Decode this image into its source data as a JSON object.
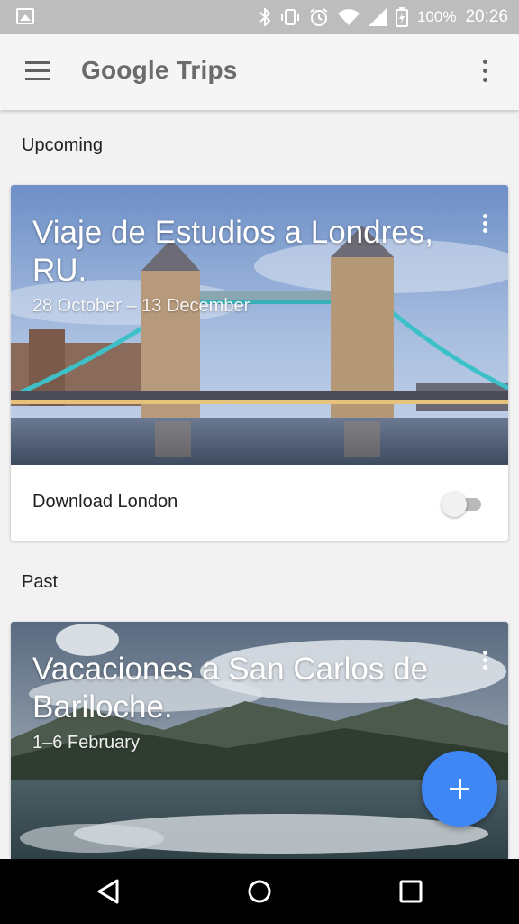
{
  "status_bar": {
    "battery": "100%",
    "time": "20:26",
    "icons": [
      "image-icon",
      "bluetooth-icon",
      "vibrate-icon",
      "alarm-icon",
      "wifi-icon",
      "cell-signal-icon",
      "battery-charging-icon"
    ]
  },
  "app_bar": {
    "title": "Google Trips",
    "menu_icon": "hamburger-menu-icon",
    "overflow_icon": "more-vert-icon"
  },
  "sections": {
    "upcoming": "Upcoming",
    "past": "Past"
  },
  "trips": [
    {
      "title": "Viaje de Estudios a Londres, RU.",
      "dates": "28 October – 13 December",
      "download_label": "Download London",
      "download_enabled": false
    },
    {
      "title": "Vacaciones a San Carlos de Bariloche.",
      "dates": "1–6 February"
    }
  ],
  "fab": {
    "icon": "add-icon"
  },
  "nav_bar": {
    "icons": [
      "back-icon",
      "home-icon",
      "recents-icon"
    ]
  }
}
